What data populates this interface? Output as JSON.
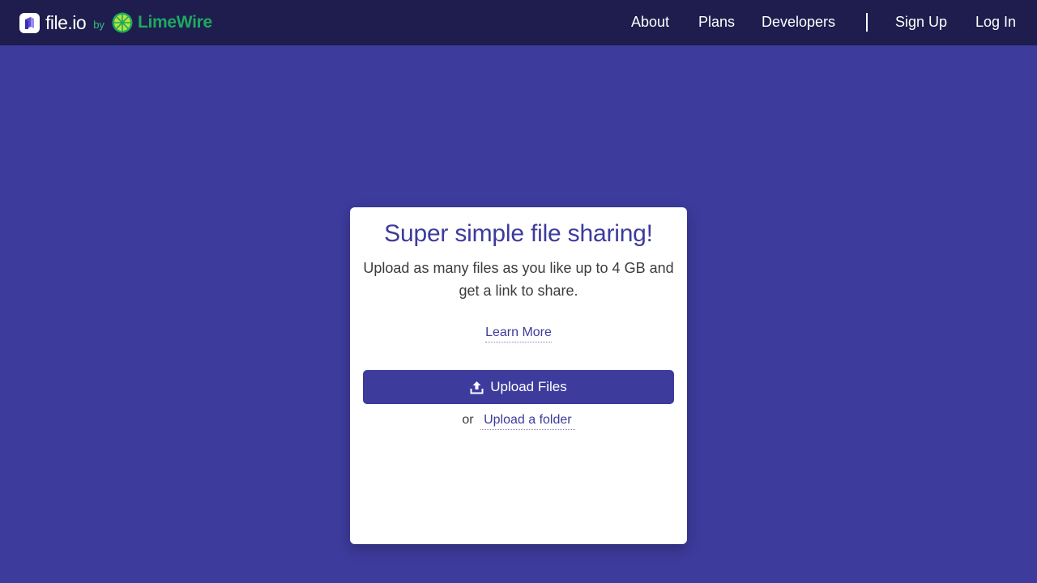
{
  "brand": {
    "name": "file.io",
    "by": "by",
    "partner": "LimeWire"
  },
  "nav": {
    "about": "About",
    "plans": "Plans",
    "developers": "Developers",
    "sign_up": "Sign Up",
    "log_in": "Log In"
  },
  "card": {
    "title": "Super simple file sharing!",
    "description": "Upload as many files as you like up to 4 GB and get a link to share.",
    "learn_more": "Learn More",
    "upload_button": "Upload Files",
    "or_text": "or",
    "upload_folder": "Upload a folder"
  },
  "icons": {
    "brand_logo": "file-io-logo-icon",
    "partner_logo": "limewire-logo-icon",
    "upload": "upload-icon"
  },
  "colors": {
    "background": "#3d3b9c",
    "topbar": "#1f1d4d",
    "accent": "#3d3b9c",
    "limewire_green": "#1ea862",
    "card": "#ffffff"
  }
}
